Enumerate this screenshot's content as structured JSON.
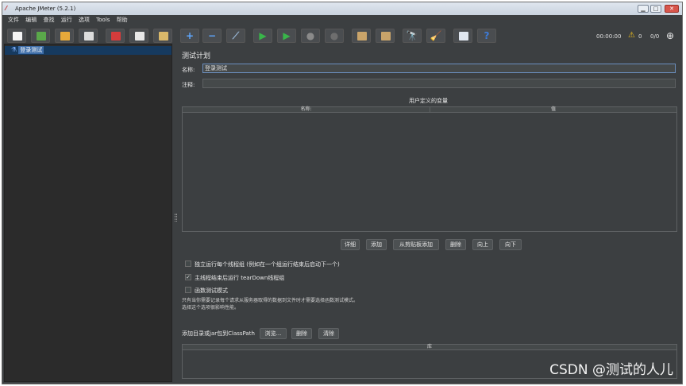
{
  "window": {
    "title": "Apache JMeter (5.2.1)",
    "min": "▁",
    "max": "□",
    "close": "✕"
  },
  "menu": [
    "文件",
    "编辑",
    "查找",
    "运行",
    "选项",
    "Tools",
    "帮助"
  ],
  "toolbar": {
    "buttons": [
      {
        "name": "new-icon",
        "color": "#f4f4f4"
      },
      {
        "name": "templates-icon",
        "color": "#5aa84a"
      },
      {
        "name": "open-icon",
        "color": "#e6a93a"
      },
      {
        "name": "save-icon",
        "color": "#dcdcdc"
      },
      {
        "name": "cut-icon",
        "color": "#d43c3c"
      },
      {
        "name": "copy-icon",
        "color": "#e8e8e8"
      },
      {
        "name": "paste-icon",
        "color": "#d9b86a"
      },
      {
        "name": "expand-icon",
        "glyph": "+",
        "color": "#5fa8ff"
      },
      {
        "name": "collapse-icon",
        "glyph": "−",
        "color": "#5fa8ff"
      },
      {
        "name": "toggle-icon",
        "glyph": "⟋",
        "color": "#9ab8d8"
      },
      {
        "name": "start-icon",
        "glyph": "▶",
        "color": "#39b54a"
      },
      {
        "name": "start-no-pauses-icon",
        "glyph": "▶",
        "color": "#39b54a"
      },
      {
        "name": "stop-icon",
        "glyph": "●",
        "color": "#8a8a8a"
      },
      {
        "name": "shutdown-icon",
        "glyph": "●",
        "color": "#6e6e6e"
      },
      {
        "name": "clear-icon",
        "color": "#c9a46a"
      },
      {
        "name": "clear-all-icon",
        "color": "#c9a46a"
      },
      {
        "name": "search-icon",
        "glyph": "🔭",
        "color": "#3a3a3a"
      },
      {
        "name": "reset-search-icon",
        "glyph": "🧹",
        "color": "#e0b030"
      },
      {
        "name": "function-helper-icon",
        "color": "#dfe6ef"
      },
      {
        "name": "help-icon",
        "glyph": "?",
        "color": "#3d7bd9"
      }
    ],
    "timer": "00:00:00",
    "warning_count": "0",
    "threads": "0/0"
  },
  "tree": {
    "root_label": "登录测试"
  },
  "panel": {
    "heading": "测试计划",
    "name_label": "名称:",
    "name_value": "登录测试",
    "comment_label": "注释:",
    "comment_value": "",
    "vars_title": "用户定义的变量",
    "vars_columns": [
      "名称:",
      "值"
    ],
    "buttons": [
      "详细",
      "添加",
      "从剪贴板添加",
      "删除",
      "向上",
      "向下"
    ],
    "options": [
      {
        "label": "独立运行每个线程组 (例如在一个组运行结束后启动下一个)",
        "checked": false
      },
      {
        "label": "主线程结束后运行 tearDown线程组",
        "checked": true
      },
      {
        "label": "函数测试模式",
        "checked": false
      }
    ],
    "note_line1": "只有当你需要记录每个请求从服务器取得的数据到文件时才需要选择函数测试模式。",
    "note_line2": "选择这个选项很影响性能。",
    "classpath_label": "添加目录或jar包到ClassPath",
    "classpath_buttons": [
      "浏览...",
      "删除",
      "清除"
    ],
    "lib_column": "库"
  },
  "watermark": "CSDN @测试的人儿"
}
